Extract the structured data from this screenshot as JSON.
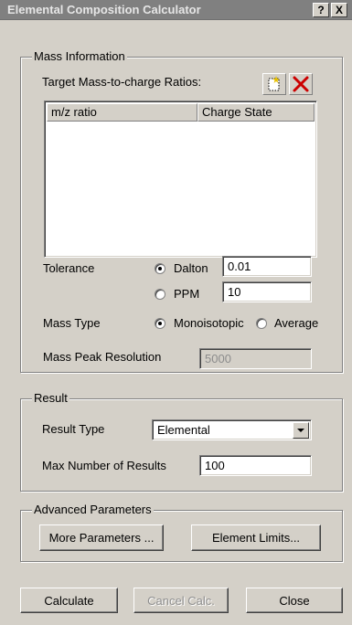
{
  "window": {
    "title": "Elemental Composition Calculator",
    "help_label": "?",
    "close_label": "X"
  },
  "mass_info": {
    "legend": "Mass Information",
    "target_label": "Target Mass-to-charge Ratios:",
    "new_icon": "new-document-icon",
    "delete_icon": "delete-x-icon",
    "table_columns": [
      "m/z ratio",
      "Charge State"
    ],
    "tolerance_label": "Tolerance",
    "dalton_label": "Dalton",
    "dalton_value": "0.01",
    "ppm_label": "PPM",
    "ppm_value": "10",
    "tolerance_selected": "Dalton",
    "mass_type_label": "Mass Type",
    "monoisotopic_label": "Monoisotopic",
    "average_label": "Average",
    "mass_type_selected": "Monoisotopic",
    "peak_resolution_label": "Mass Peak Resolution",
    "peak_resolution_value": "5000"
  },
  "result": {
    "legend": "Result",
    "result_type_label": "Result Type",
    "result_type_value": "Elemental",
    "max_results_label": "Max Number of Results",
    "max_results_value": "100"
  },
  "advanced": {
    "legend": "Advanced Parameters",
    "more_parameters_label": "More Parameters ...",
    "element_limits_label": "Element Limits..."
  },
  "footer": {
    "calculate_label": "Calculate",
    "cancel_label": "Cancel Calc.",
    "close_label": "Close"
  },
  "colors": {
    "titlebar": "#808080",
    "face": "#d4d0c8",
    "delete_red": "#cc0000"
  }
}
